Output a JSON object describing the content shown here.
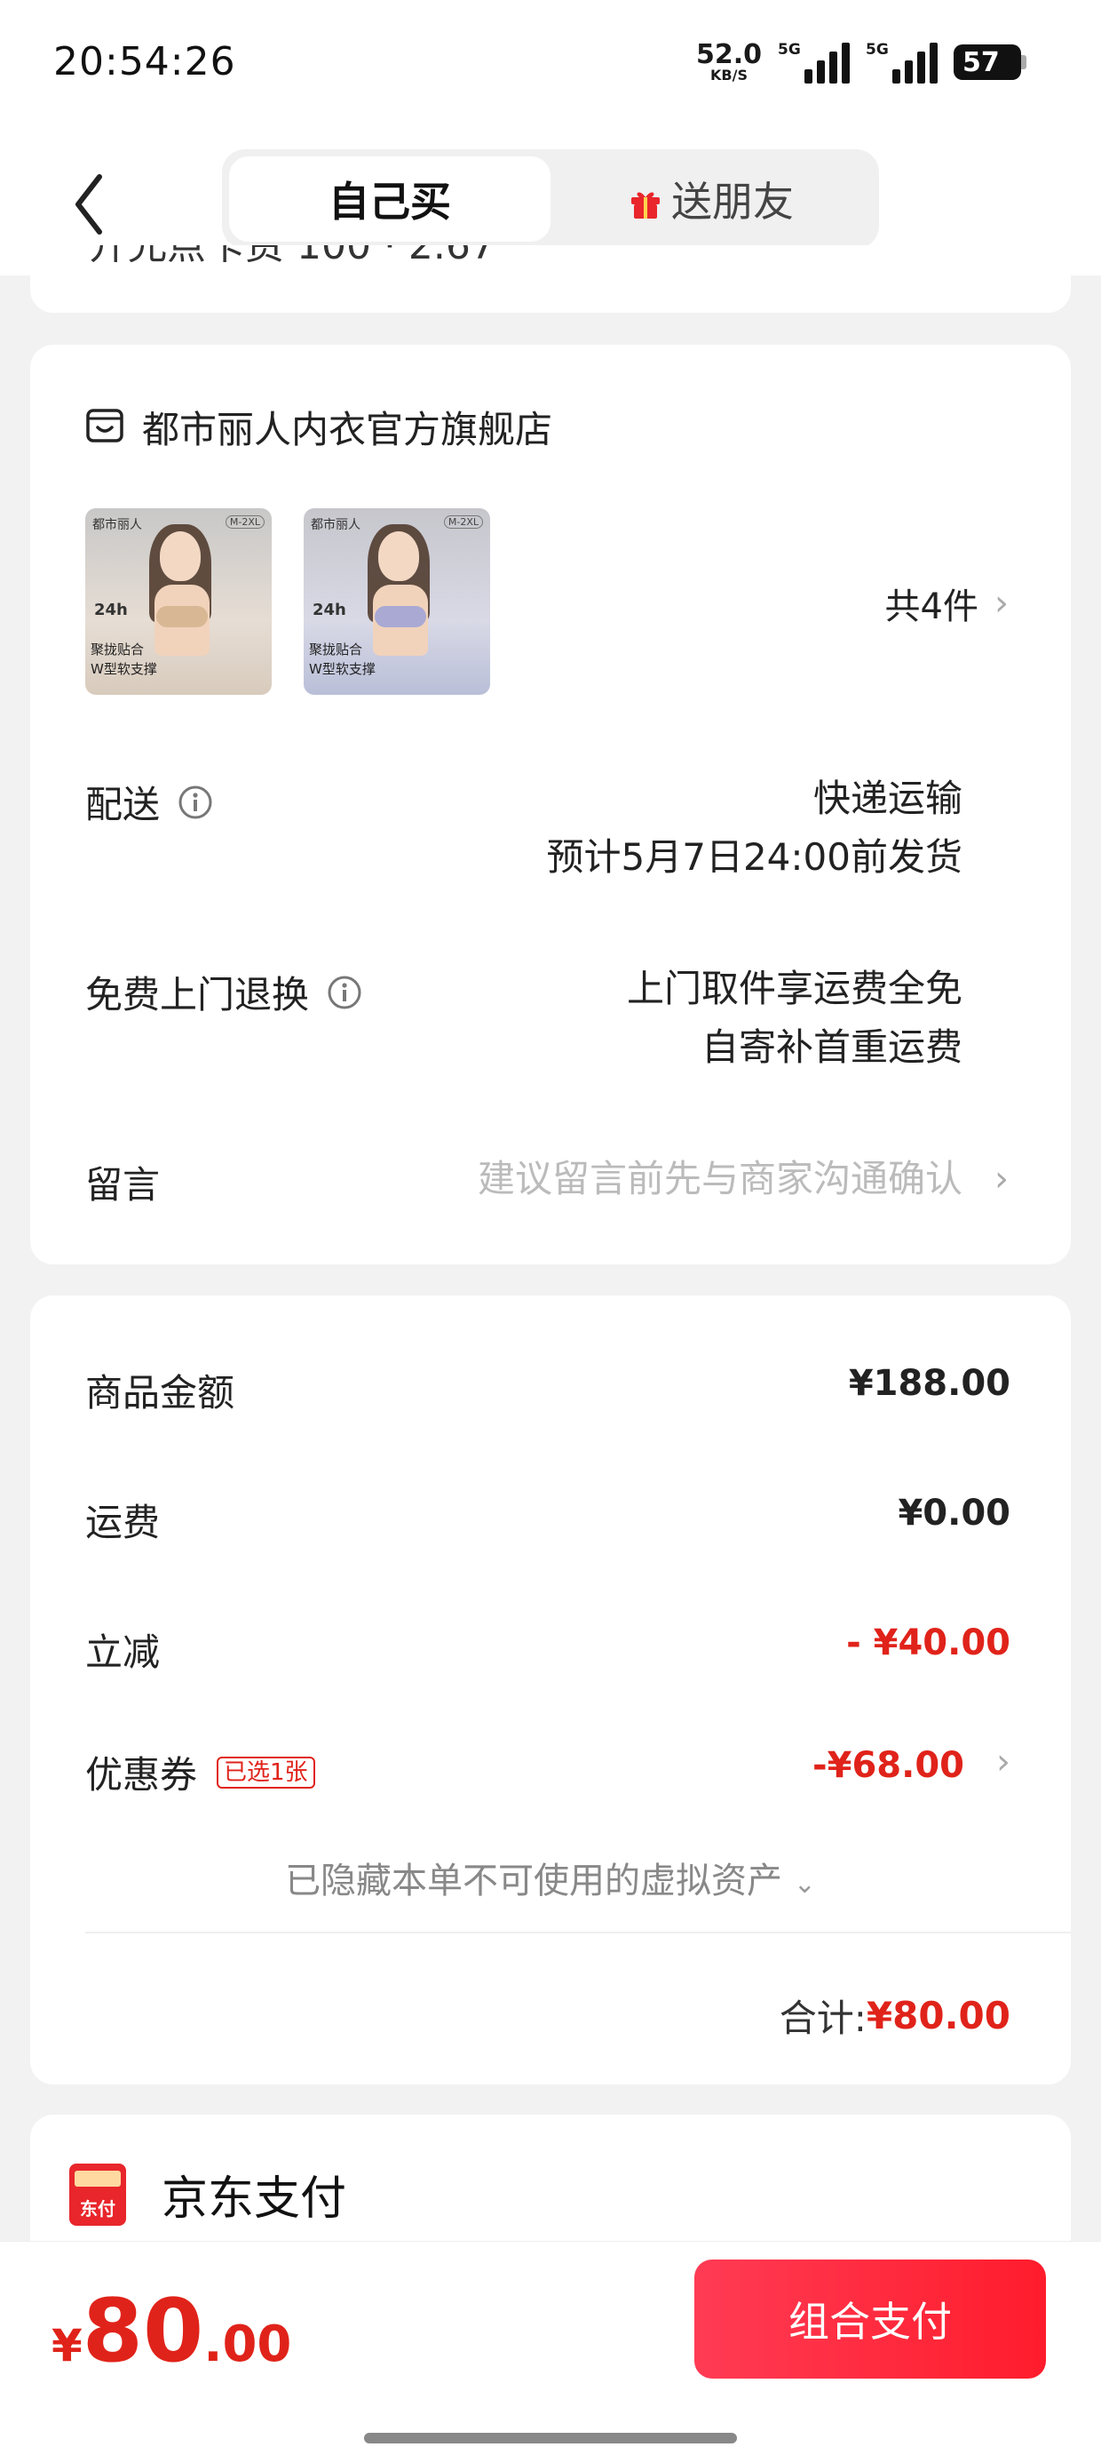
{
  "status_bar": {
    "time": "20:54:26",
    "net_speed": "52.0",
    "net_unit": "KB/S",
    "signal1_label": "5G",
    "signal2_label": "5G",
    "battery": "57"
  },
  "header": {
    "tabs": [
      {
        "label": "自己买",
        "active": true
      },
      {
        "label": "送朋友",
        "active": false
      }
    ]
  },
  "top_card": {
    "clipped_text": "开允点卡资 100 · 2.67"
  },
  "shop": {
    "name": "都市丽人内衣官方旗舰店",
    "products": [
      {
        "brand": "都市丽人",
        "size": "M-2XL",
        "badge": "24h",
        "caption1": "聚拢贴合",
        "caption2": "W型软支撑"
      },
      {
        "brand": "都市丽人",
        "size": "M-2XL",
        "badge": "24h",
        "caption1": "聚拢贴合",
        "caption2": "W型软支撑"
      }
    ],
    "count": "共4件"
  },
  "delivery": {
    "label": "配送",
    "method": "快递运输",
    "eta": "预计5月7日24:00前发货"
  },
  "return": {
    "label": "免费上门退换",
    "line1": "上门取件享运费全免",
    "line2": "自寄补首重运费"
  },
  "note": {
    "label": "留言",
    "placeholder": "建议留言前先与商家沟通确认"
  },
  "amounts": {
    "goods_label": "商品金额",
    "goods_value": "¥188.00",
    "shipping_label": "运费",
    "shipping_value": "¥0.00",
    "discount_label": "立减",
    "discount_value": "- ¥40.00",
    "coupon_label": "优惠券",
    "coupon_tag": "已选1张",
    "coupon_value": "-¥68.00",
    "hidden_assets": "已隐藏本单不可使用的虚拟资产",
    "total_label": "合计:",
    "total_value": "¥80.00"
  },
  "payment": {
    "method": "京东支付",
    "icon_text": "东付"
  },
  "bottom": {
    "currency": "¥",
    "price_int": "80",
    "price_dec": ".00",
    "pay_button": "组合支付"
  },
  "colors": {
    "accent_red": "#e0231a",
    "button_red": "#ff1c2c"
  }
}
